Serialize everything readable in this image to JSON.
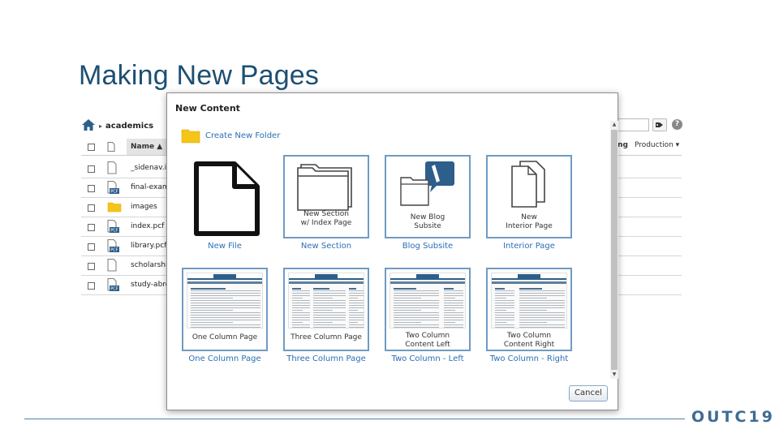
{
  "slide": {
    "title": "Making New Pages",
    "brand": "OUTC19"
  },
  "file_manager": {
    "breadcrumb": "academics",
    "column_name": "Name ▲",
    "column_right_1": "ing",
    "column_right_2": "Production ▾",
    "rows": [
      {
        "name": "_sidenav.in",
        "type": "file"
      },
      {
        "name": "final-exam-",
        "type": "pdf"
      },
      {
        "name": "images",
        "type": "folder"
      },
      {
        "name": "index.pcf",
        "type": "pdf"
      },
      {
        "name": "library.pcf",
        "type": "pdf"
      },
      {
        "name": "scholarship",
        "type": "file"
      },
      {
        "name": "study-abroa",
        "type": "pdf"
      }
    ],
    "help_label": "?",
    "pdf_badge": "PCF"
  },
  "modal": {
    "title": "New Content",
    "create_folder": "Create New Folder",
    "tiles": [
      {
        "label": "New File",
        "caption": ""
      },
      {
        "label": "New Section",
        "caption": "New Section\nw/ Index Page"
      },
      {
        "label": "Blog Subsite",
        "caption": "New Blog\nSubsite"
      },
      {
        "label": "Interior Page",
        "caption": "New\nInterior Page"
      },
      {
        "label": "One Column Page",
        "caption": "One Column Page"
      },
      {
        "label": "Three Column Page",
        "caption": "Three Column Page"
      },
      {
        "label": "Two Column - Left",
        "caption": "Two Column\nContent Left"
      },
      {
        "label": "Two Column - Right",
        "caption": "Two Column\nContent Right"
      }
    ],
    "cancel": "Cancel"
  },
  "colors": {
    "title": "#1d4f72",
    "link": "#2a6fb4",
    "tile_border": "#6f9bc2",
    "folder": "#f5c518",
    "brand": "#3f6c95"
  }
}
